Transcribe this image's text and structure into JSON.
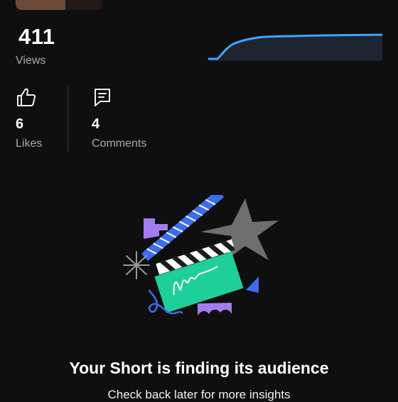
{
  "views": {
    "value": "411",
    "label": "Views",
    "trend_color": "#3ea6ff"
  },
  "stats": {
    "likes": {
      "value": "6",
      "label": "Likes",
      "icon": "thumb-up-icon"
    },
    "comments": {
      "value": "4",
      "label": "Comments",
      "icon": "comment-icon"
    }
  },
  "empty_state": {
    "title": "Your Short is finding its audience",
    "subtitle": "Check back later for more insights"
  },
  "colors": {
    "background": "#0f0f0f",
    "accent": "#3ea6ff",
    "text_secondary": "#aaaaaa"
  }
}
